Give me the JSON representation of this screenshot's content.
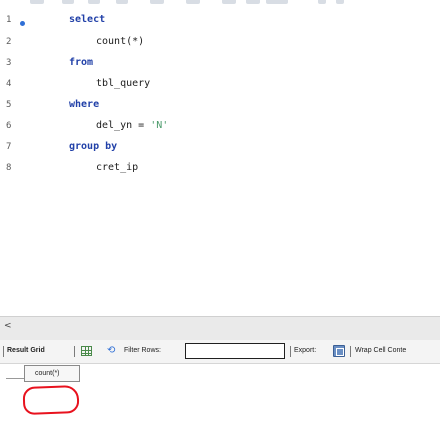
{
  "editor": {
    "line_numbers": [
      "1",
      "2",
      "3",
      "4",
      "5",
      "6",
      "7",
      "8"
    ],
    "lines": [
      {
        "tokens": [
          {
            "text": "select",
            "kind": "keyword"
          }
        ]
      },
      {
        "tokens": [
          {
            "text": "count(*)",
            "kind": "identifier"
          }
        ]
      },
      {
        "tokens": [
          {
            "text": "from",
            "kind": "keyword"
          }
        ]
      },
      {
        "tokens": [
          {
            "text": "tbl_query",
            "kind": "identifier"
          }
        ]
      },
      {
        "tokens": [
          {
            "text": "where",
            "kind": "keyword"
          }
        ]
      },
      {
        "tokens": [
          {
            "text": "del_yn = ",
            "kind": "identifier"
          },
          {
            "text": "'N'",
            "kind": "string"
          }
        ]
      },
      {
        "tokens": [
          {
            "text": "group by",
            "kind": "keyword"
          }
        ]
      },
      {
        "tokens": [
          {
            "text": "cret_ip",
            "kind": "identifier"
          }
        ]
      }
    ],
    "active_line_marker": "•"
  },
  "hscroll": {
    "left_arrow": "<"
  },
  "result_toolbar": {
    "result_grid_label": "Result Grid",
    "refresh_glyph": "⟲",
    "filter_rows_label": "Filter Rows:",
    "filter_rows_value": "",
    "export_label": "Export:",
    "wrap_label": "Wrap Cell Conte"
  },
  "result_grid": {
    "columns": [
      "count(*)"
    ]
  },
  "colors": {
    "keyword": "#2140a8",
    "string": "#4a9a6a",
    "annotation": "#e8121e"
  }
}
